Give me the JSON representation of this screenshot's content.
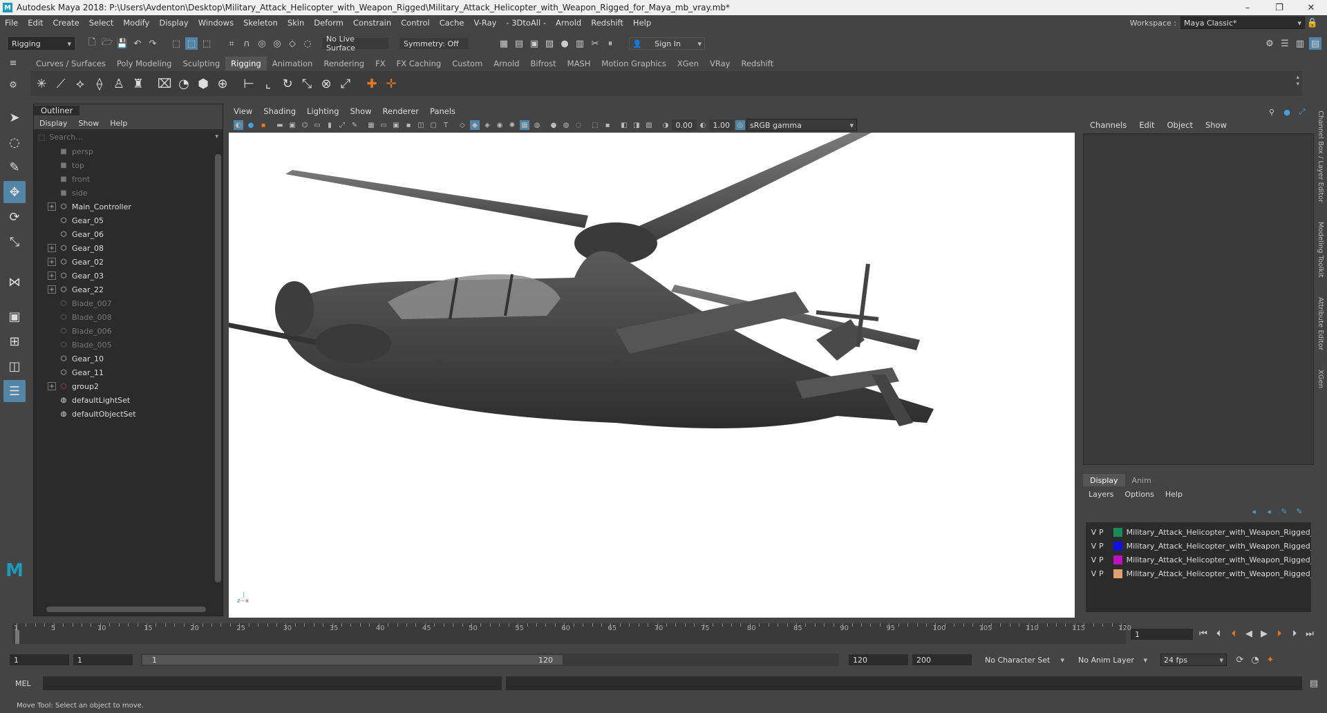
{
  "title": "Autodesk Maya 2018: P:\\Users\\Avdenton\\Desktop\\Military_Attack_Helicopter_with_Weapon_Rigged\\Military_Attack_Helicopter_with_Weapon_Rigged_for_Maya_mb_vray.mb*",
  "window_controls": {
    "minimize": "–",
    "maximize": "❐",
    "close": "✕"
  },
  "menu": [
    "File",
    "Edit",
    "Create",
    "Select",
    "Modify",
    "Display",
    "Windows",
    "Skeleton",
    "Skin",
    "Deform",
    "Constrain",
    "Control",
    "Cache",
    "V-Ray",
    "- 3DtoAll -",
    "Arnold",
    "Redshift",
    "Help"
  ],
  "workspace": {
    "label": "Workspace :",
    "value": "Maya Classic*"
  },
  "status": {
    "menuset": "Rigging",
    "live_surface": "No Live Surface",
    "symmetry": "Symmetry: Off",
    "sign_in": "Sign In"
  },
  "shelf_tabs": [
    "Curves / Surfaces",
    "Poly Modeling",
    "Sculpting",
    "Rigging",
    "Animation",
    "Rendering",
    "FX",
    "FX Caching",
    "Custom",
    "Arnold",
    "Bifrost",
    "MASH",
    "Motion Graphics",
    "XGen",
    "VRay",
    "Redshift"
  ],
  "shelf_active": "Rigging",
  "outliner": {
    "title": "Outliner",
    "menu": [
      "Display",
      "Show",
      "Help"
    ],
    "search_placeholder": "Search...",
    "items": [
      {
        "label": "persp",
        "dim": true,
        "exp": false,
        "icon": "camera"
      },
      {
        "label": "top",
        "dim": true,
        "exp": false,
        "icon": "camera"
      },
      {
        "label": "front",
        "dim": true,
        "exp": false,
        "icon": "camera"
      },
      {
        "label": "side",
        "dim": true,
        "exp": false,
        "icon": "camera"
      },
      {
        "label": "Main_Controller",
        "dim": false,
        "exp": true,
        "icon": "transform"
      },
      {
        "label": "Gear_05",
        "dim": false,
        "exp": false,
        "icon": "transform"
      },
      {
        "label": "Gear_06",
        "dim": false,
        "exp": false,
        "icon": "transform"
      },
      {
        "label": "Gear_08",
        "dim": false,
        "exp": true,
        "icon": "transform"
      },
      {
        "label": "Gear_02",
        "dim": false,
        "exp": true,
        "icon": "transform"
      },
      {
        "label": "Gear_03",
        "dim": false,
        "exp": true,
        "icon": "transform"
      },
      {
        "label": "Gear_22",
        "dim": false,
        "exp": true,
        "icon": "transform"
      },
      {
        "label": "Blade_007",
        "dim": true,
        "exp": false,
        "icon": "transform"
      },
      {
        "label": "Blade_008",
        "dim": true,
        "exp": false,
        "icon": "transform"
      },
      {
        "label": "Blade_006",
        "dim": true,
        "exp": false,
        "icon": "transform"
      },
      {
        "label": "Blade_005",
        "dim": true,
        "exp": false,
        "icon": "transform"
      },
      {
        "label": "Gear_10",
        "dim": false,
        "exp": false,
        "icon": "transform"
      },
      {
        "label": "Gear_11",
        "dim": false,
        "exp": false,
        "icon": "transform"
      },
      {
        "label": "group2",
        "dim": false,
        "exp": true,
        "icon": "group"
      },
      {
        "label": "defaultLightSet",
        "dim": false,
        "exp": false,
        "icon": "set"
      },
      {
        "label": "defaultObjectSet",
        "dim": false,
        "exp": false,
        "icon": "set"
      }
    ]
  },
  "viewport": {
    "menu": [
      "View",
      "Shading",
      "Lighting",
      "Show",
      "Renderer",
      "Panels"
    ],
    "exposure": "0.00",
    "gamma": "1.00",
    "colorspace": "sRGB gamma",
    "axis_x": "x",
    "axis_z": "z"
  },
  "channel_box": {
    "menu": [
      "Channels",
      "Edit",
      "Object",
      "Show"
    ]
  },
  "side_tabs": [
    "Channel Box / Layer Editor",
    "Modeling Toolkit",
    "Attribute Editor",
    "XGen"
  ],
  "layers": {
    "tabs": [
      "Display",
      "Anim"
    ],
    "menu": [
      "Layers",
      "Options",
      "Help"
    ],
    "rows": [
      {
        "v": "V",
        "p": "P",
        "color": "#1a8a5a",
        "name": "Military_Attack_Helicopter_with_Weapon_Rigged_Bo"
      },
      {
        "v": "V",
        "p": "P",
        "color": "#1010e0",
        "name": "Military_Attack_Helicopter_with_Weapon_Rigged_Ge"
      },
      {
        "v": "V",
        "p": "P",
        "color": "#c010c0",
        "name": "Military_Attack_Helicopter_with_Weapon_Rigged_Co"
      },
      {
        "v": "V",
        "p": "P",
        "color": "#e0a070",
        "name": "Military_Attack_Helicopter_with_Weapon_Rigged_He"
      }
    ]
  },
  "timeline": {
    "ticks": [
      "1",
      "5",
      "10",
      "15",
      "20",
      "25",
      "30",
      "35",
      "40",
      "45",
      "50",
      "55",
      "60",
      "65",
      "70",
      "75",
      "80",
      "85",
      "90",
      "95",
      "100",
      "105",
      "110",
      "115",
      "120"
    ],
    "current": "1"
  },
  "range": {
    "start": "1",
    "start2": "1",
    "inner_start": "1",
    "inner_end": "120",
    "end": "120",
    "end2": "200",
    "character_set": "No Character Set",
    "anim_layer": "No Anim Layer",
    "fps": "24 fps"
  },
  "cmd": {
    "label": "MEL"
  },
  "help_text": "Move Tool: Select an object to move."
}
